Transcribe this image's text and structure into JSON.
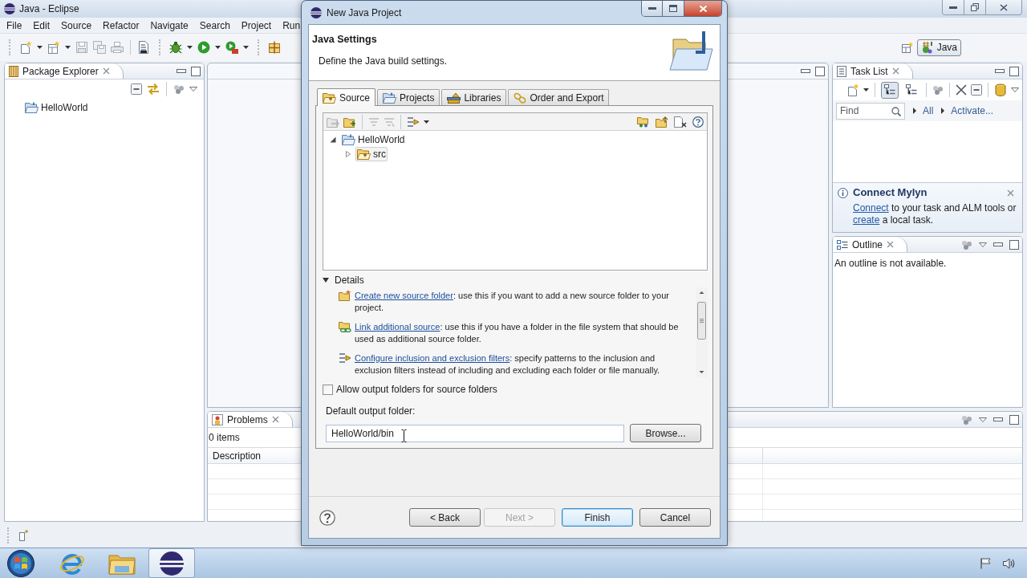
{
  "window": {
    "title": "Java - Eclipse"
  },
  "menu_bar": [
    "File",
    "Edit",
    "Source",
    "Refactor",
    "Navigate",
    "Search",
    "Project",
    "Run"
  ],
  "perspectives": [
    {
      "label": "Java",
      "selected": true
    }
  ],
  "package_explorer": {
    "title": "Package Explorer",
    "items": [
      {
        "label": "HelloWorld"
      }
    ]
  },
  "task_list": {
    "title": "Task List",
    "toolbar_toggles": [
      {
        "selected": true
      },
      {
        "selected": false
      }
    ],
    "find": {
      "placeholder": "Find"
    },
    "filters": [
      "All",
      "Activate..."
    ]
  },
  "connect_mylyn": {
    "title": "Connect Mylyn",
    "message": [
      {
        "kind": "link",
        "text": "Connect"
      },
      {
        "kind": "text",
        "text": " to your task and ALM tools or "
      },
      {
        "kind": "link",
        "text": "create"
      },
      {
        "kind": "text",
        "text": " a local task."
      }
    ]
  },
  "outline": {
    "title": "Outline",
    "message": "An outline is not available."
  },
  "problems": {
    "title": "Problems",
    "count": "0 items",
    "columns": [
      "Description"
    ]
  },
  "taskbar": {
    "apps": [
      {
        "kind": "browser",
        "selected": false
      },
      {
        "kind": "folder",
        "selected": false
      },
      {
        "kind": "eclipse",
        "selected": true
      }
    ]
  },
  "dialog": {
    "title": "New Java Project",
    "heading": "Java Settings",
    "description": "Define the Java build settings.",
    "tabs": [
      {
        "label": "Source",
        "kind": "source",
        "selected": true
      },
      {
        "label": "Projects",
        "kind": "projects",
        "selected": false
      },
      {
        "label": "Libraries",
        "kind": "libraries",
        "selected": false
      },
      {
        "label": "Order and Export",
        "kind": "order",
        "selected": false
      }
    ],
    "tree": [
      {
        "label": "HelloWorld",
        "kind": "project",
        "expanded": true,
        "selected": false,
        "children": [
          {
            "label": "src",
            "kind": "source_folder",
            "expanded": false,
            "selected": true
          }
        ]
      }
    ],
    "details": {
      "title": "Details",
      "expanded": true,
      "items": [
        {
          "kind": "create",
          "link": "Create new source folder",
          "text": ": use this if you want to add a new source folder to your project."
        },
        {
          "kind": "link",
          "link": "Link additional source",
          "text": ": use this if you have a folder in the file system that should be used as additional source folder."
        },
        {
          "kind": "filter",
          "link": "Configure inclusion and exclusion filters",
          "text": ": specify patterns to the inclusion and exclusion filters instead of including and excluding each folder or file manually."
        }
      ]
    },
    "allow_output_folders": {
      "label": "Allow output folders for source folders",
      "checked": false
    },
    "output_folder": {
      "label": "Default output folder:",
      "value": "HelloWorld/bin",
      "button": "Browse..."
    },
    "buttons": [
      {
        "label": "< Back",
        "disabled": false,
        "default": false
      },
      {
        "label": "Next >",
        "disabled": true,
        "default": false
      },
      {
        "label": "Finish",
        "disabled": false,
        "default": true
      },
      {
        "label": "Cancel",
        "disabled": false,
        "default": false
      }
    ]
  }
}
